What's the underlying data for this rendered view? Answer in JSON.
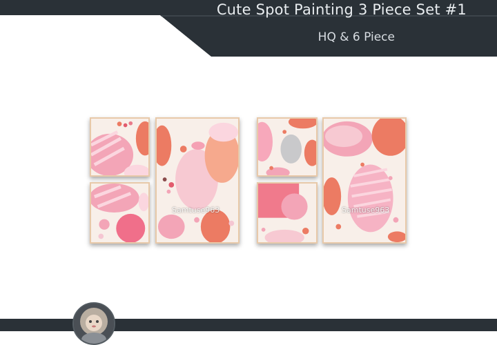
{
  "header": {
    "title": "Cute Spot Painting 3 Piece Set #1",
    "subtitle": "HQ & 6 Piece"
  },
  "watermarks": [
    "Samtuse963",
    "Samtuse963"
  ],
  "colors": {
    "banner": "#2a3137",
    "frame": "#e8c9a9",
    "pink": "#f3a5b7",
    "coral": "#ec7b63",
    "cream": "#f8efe9"
  },
  "icons": {
    "avatar": "doll-avatar-icon"
  }
}
